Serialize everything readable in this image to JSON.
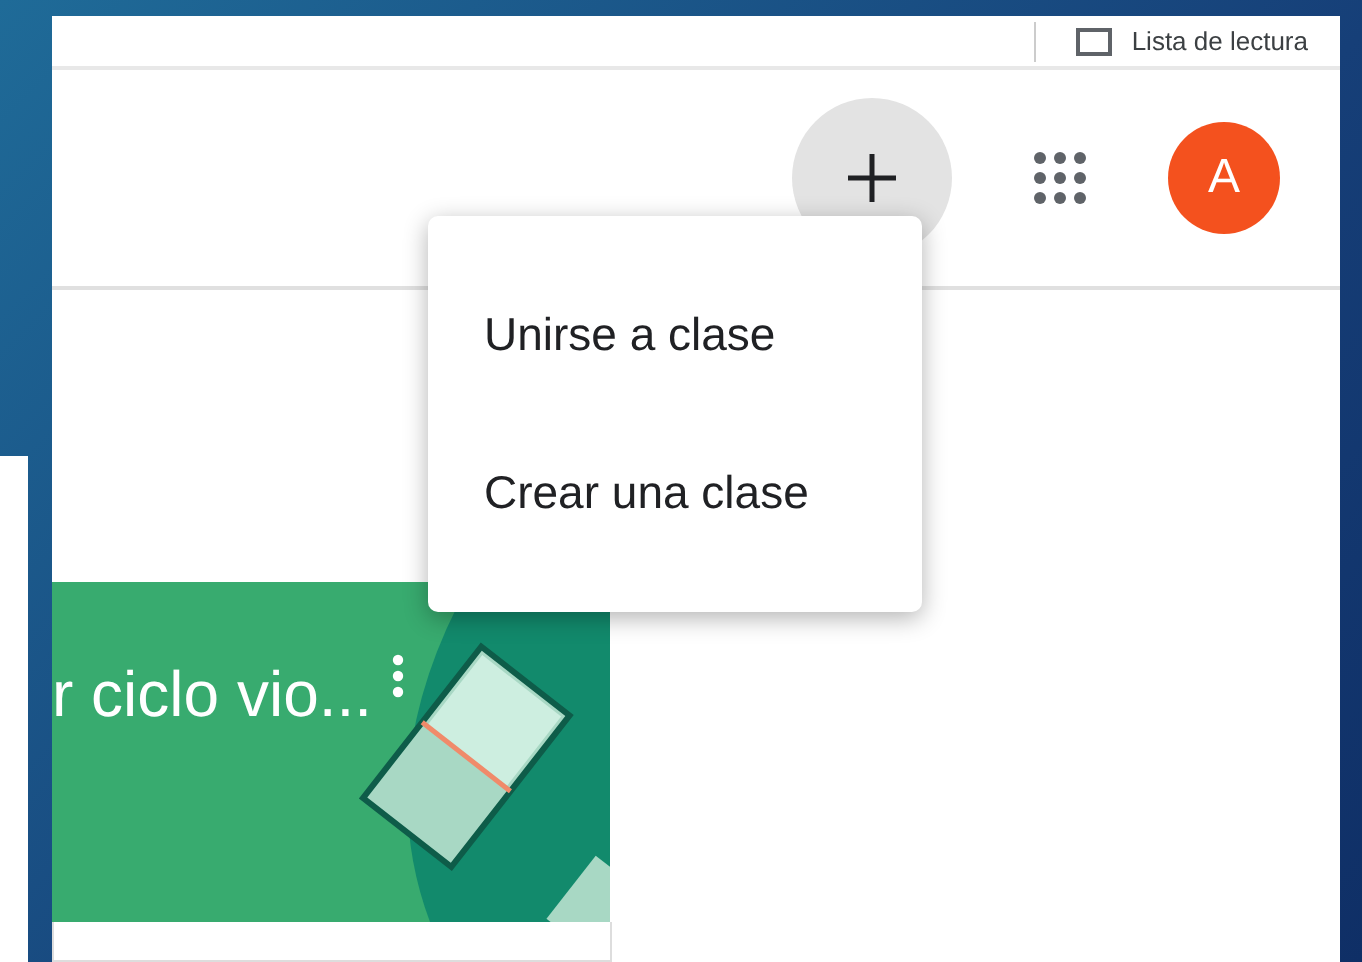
{
  "bookmarks_bar": {
    "reading_list": "Lista de lectura"
  },
  "header": {
    "avatar": {
      "initial": "A",
      "color": "#f4511e"
    }
  },
  "add_menu": {
    "open": true,
    "items": [
      {
        "label": "Unirse a clase"
      },
      {
        "label": "Crear una clase"
      }
    ]
  },
  "class_card": {
    "title": "r ciclo vio..."
  }
}
